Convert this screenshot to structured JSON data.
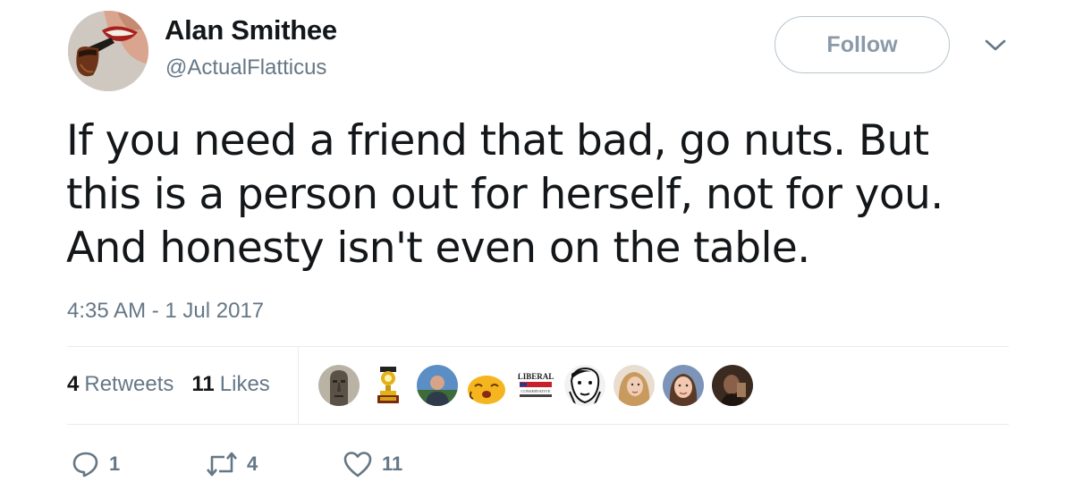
{
  "author": {
    "name": "Alan Smithee",
    "handle": "@ActualFlatticus",
    "avatar_icon": "pipe-smoking-face-icon"
  },
  "follow_button": {
    "label": "Follow"
  },
  "menu_icon": "chevron-down-icon",
  "tweet": {
    "lines": [
      "If you need a friend that bad, go nuts.  But",
      "this is a person out for herself, not for you.",
      "And honesty isn't even on the table."
    ],
    "timestamp": "4:35 AM - 1 Jul 2017"
  },
  "stats": {
    "retweets_count": "4",
    "retweets_label": "Retweets",
    "likes_count": "11",
    "likes_label": "Likes"
  },
  "likers": [
    {
      "name": "moai-statue-avatar"
    },
    {
      "name": "trophy-avatar"
    },
    {
      "name": "man-outdoors-avatar"
    },
    {
      "name": "yellow-cartoon-avatar",
      "color": "#f5b51f"
    },
    {
      "name": "liberal-conservative-logo-avatar",
      "text": "LIBERAL",
      "subtext": "CONSERVATIVE"
    },
    {
      "name": "sketch-face-avatar"
    },
    {
      "name": "blonde-woman-avatar"
    },
    {
      "name": "girl-portrait-avatar"
    },
    {
      "name": "dark-portrait-avatar"
    }
  ],
  "actions": {
    "reply_count": "1",
    "retweet_count": "4",
    "like_count": "11"
  },
  "colors": {
    "text_primary": "#14171a",
    "text_secondary": "#657786",
    "divider": "#e6ecf0",
    "follow_border": "#b8c4cc"
  }
}
